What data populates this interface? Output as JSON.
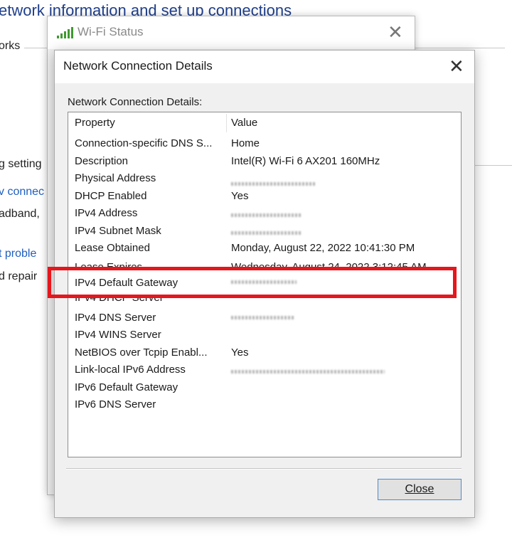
{
  "background": {
    "heading": "etwork information and set up connections",
    "side_texts": [
      {
        "text": "orks",
        "is_link": false
      },
      {
        "text": "g setting",
        "is_link": false
      },
      {
        "text": "v connec",
        "is_link": true
      },
      {
        "text": "adband,",
        "is_link": false
      },
      {
        "text": "t proble",
        "is_link": true
      },
      {
        "text": "d repair",
        "is_link": false
      }
    ]
  },
  "wifi_window": {
    "title": "Wi-Fi Status",
    "icon": "wifi-signal-icon",
    "close_glyph": "✕"
  },
  "details_dialog": {
    "title": "Network Connection Details",
    "close_glyph": "✕",
    "list_label": "Network Connection Details:",
    "columns": {
      "property": "Property",
      "value": "Value"
    },
    "rows": [
      {
        "property": "Connection-specific DNS S...",
        "value": "Home"
      },
      {
        "property": "Description",
        "value": "Intel(R) Wi-Fi 6 AX201 160MHz"
      },
      {
        "property": "Physical Address",
        "value": "",
        "obscured": true
      },
      {
        "property": "DHCP Enabled",
        "value": "Yes"
      },
      {
        "property": "IPv4 Address",
        "value": "",
        "obscured": true
      },
      {
        "property": "IPv4 Subnet Mask",
        "value": "",
        "obscured": true
      },
      {
        "property": "Lease Obtained",
        "value": "Monday, August 22, 2022 10:41:30 PM"
      },
      {
        "property": "Lease Expires",
        "value": "Wednesday, August 24, 2022 3:12:45 AM"
      },
      {
        "property": "IPv4 Default Gateway",
        "value": "",
        "obscured": true
      },
      {
        "property": "IPv4 DHCP Server",
        "value": "",
        "obscured": true
      },
      {
        "property": "IPv4 DNS Server",
        "value": "",
        "obscured": true
      },
      {
        "property": "IPv4 WINS Server",
        "value": ""
      },
      {
        "property": "NetBIOS over Tcpip Enabl...",
        "value": "Yes"
      },
      {
        "property": "Link-local IPv6 Address",
        "value": "",
        "obscured": true
      },
      {
        "property": "IPv6 Default Gateway",
        "value": ""
      },
      {
        "property": "IPv6 DNS Server",
        "value": ""
      }
    ],
    "close_button_label": "Close"
  },
  "annotation": {
    "highlight_color": "#e5161c"
  }
}
